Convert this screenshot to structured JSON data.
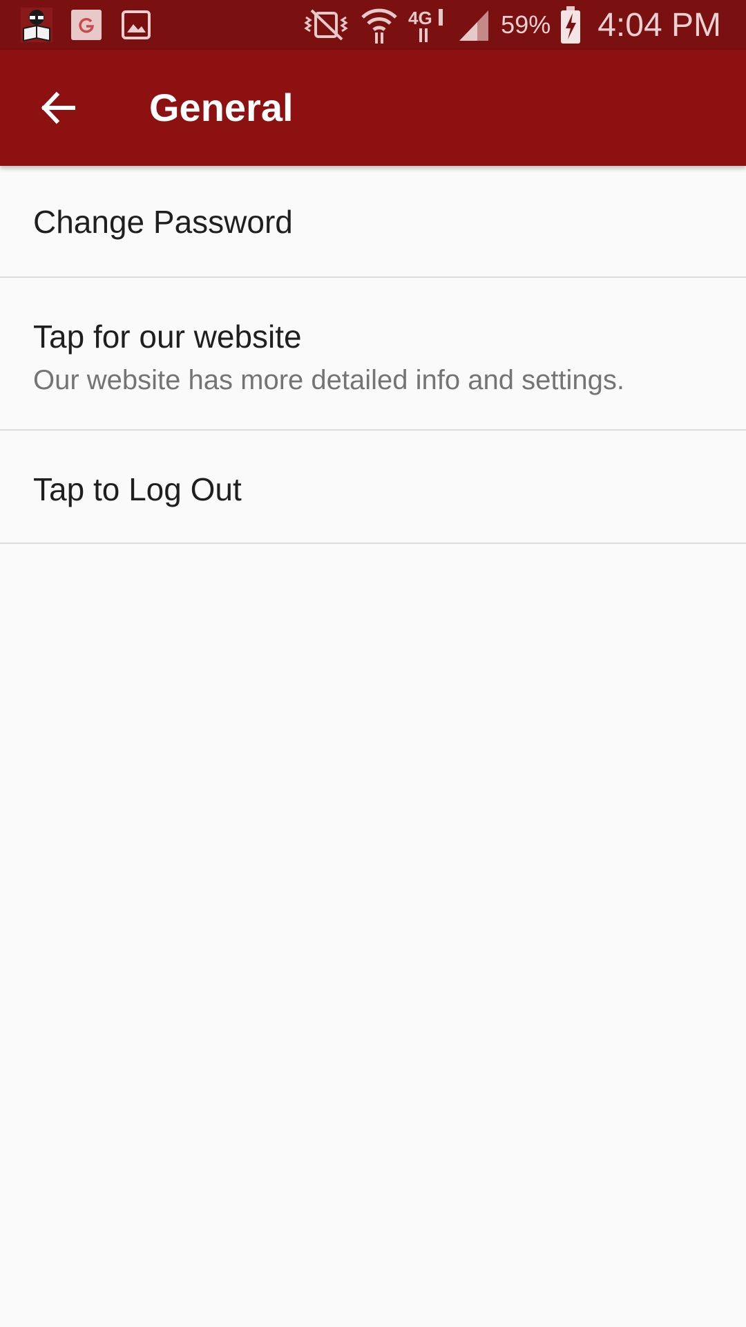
{
  "status_bar": {
    "notification_icons": [
      "app-reader-icon",
      "google-icon",
      "image-icon"
    ],
    "system_icons": [
      "vibrate-mute-icon",
      "wifi-icon",
      "lte-4g-icon",
      "cell-signal-icon",
      "battery-charging-icon"
    ],
    "network_label": "4G",
    "battery_percent": "59%",
    "time": "4:04 PM"
  },
  "app_bar": {
    "title": "General",
    "background": "#8e1112",
    "status_background": "#7a1010"
  },
  "settings": [
    {
      "title": "Change Password",
      "summary": ""
    },
    {
      "title": "Tap for our website",
      "summary": "Our website has more detailed info and settings."
    },
    {
      "title": "Tap to Log Out",
      "summary": ""
    }
  ]
}
